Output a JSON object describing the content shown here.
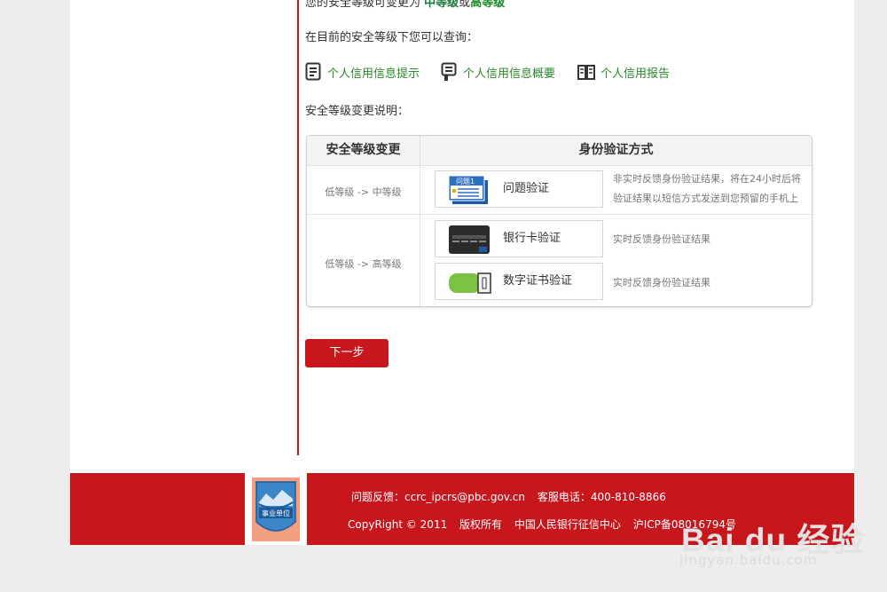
{
  "intro": {
    "line1_prefix": "您的安全等级可变更为",
    "mid_level": "中等级",
    "or": "或",
    "high_level": "高等级",
    "line2": "在目前的安全等级下您可以查询：",
    "line3": "安全等级变更说明："
  },
  "queries": [
    {
      "label": "个人信用信息提示",
      "icon": "document-list-icon"
    },
    {
      "label": "个人信用信息概要",
      "icon": "document-summary-icon"
    },
    {
      "label": "个人信用报告",
      "icon": "open-book-icon"
    }
  ],
  "table": {
    "header_level": "安全等级变更",
    "header_method": "身份验证方式",
    "row1_level": "低等级 -> 中等级",
    "row2_level": "低等级 -> 高等级",
    "methods": [
      {
        "label": "问题验证",
        "icon_text": "问题1",
        "desc_line1": "非实时反馈身份验证结果，将在24小时后将",
        "desc_line2": "验证结果以短信方式发送到您预留的手机上"
      },
      {
        "label": "银行卡验证",
        "icon_text": "",
        "desc_line1": "实时反馈身份验证结果",
        "desc_line2": ""
      },
      {
        "label": "数字证书验证",
        "icon_text": "",
        "desc_line1": "实时反馈身份验证结果",
        "desc_line2": ""
      }
    ]
  },
  "next_button": "下一步",
  "footer": {
    "badge_text": "事业单位",
    "feedback": "问题反馈：ccrc_ipcrs@pbc.gov.cn",
    "hotline": "客服电话：400-810-8866",
    "copyright": "CopyRight © 2011",
    "rights": "版权所有",
    "org": "中国人民银行征信中心",
    "icp": "沪ICP备08016794号"
  },
  "watermark": {
    "logo": "Bai du 经验",
    "url": "jingyan.baidu.com"
  },
  "colors": {
    "brand_red": "#c8161d",
    "link_green": "#2a8a2a"
  }
}
